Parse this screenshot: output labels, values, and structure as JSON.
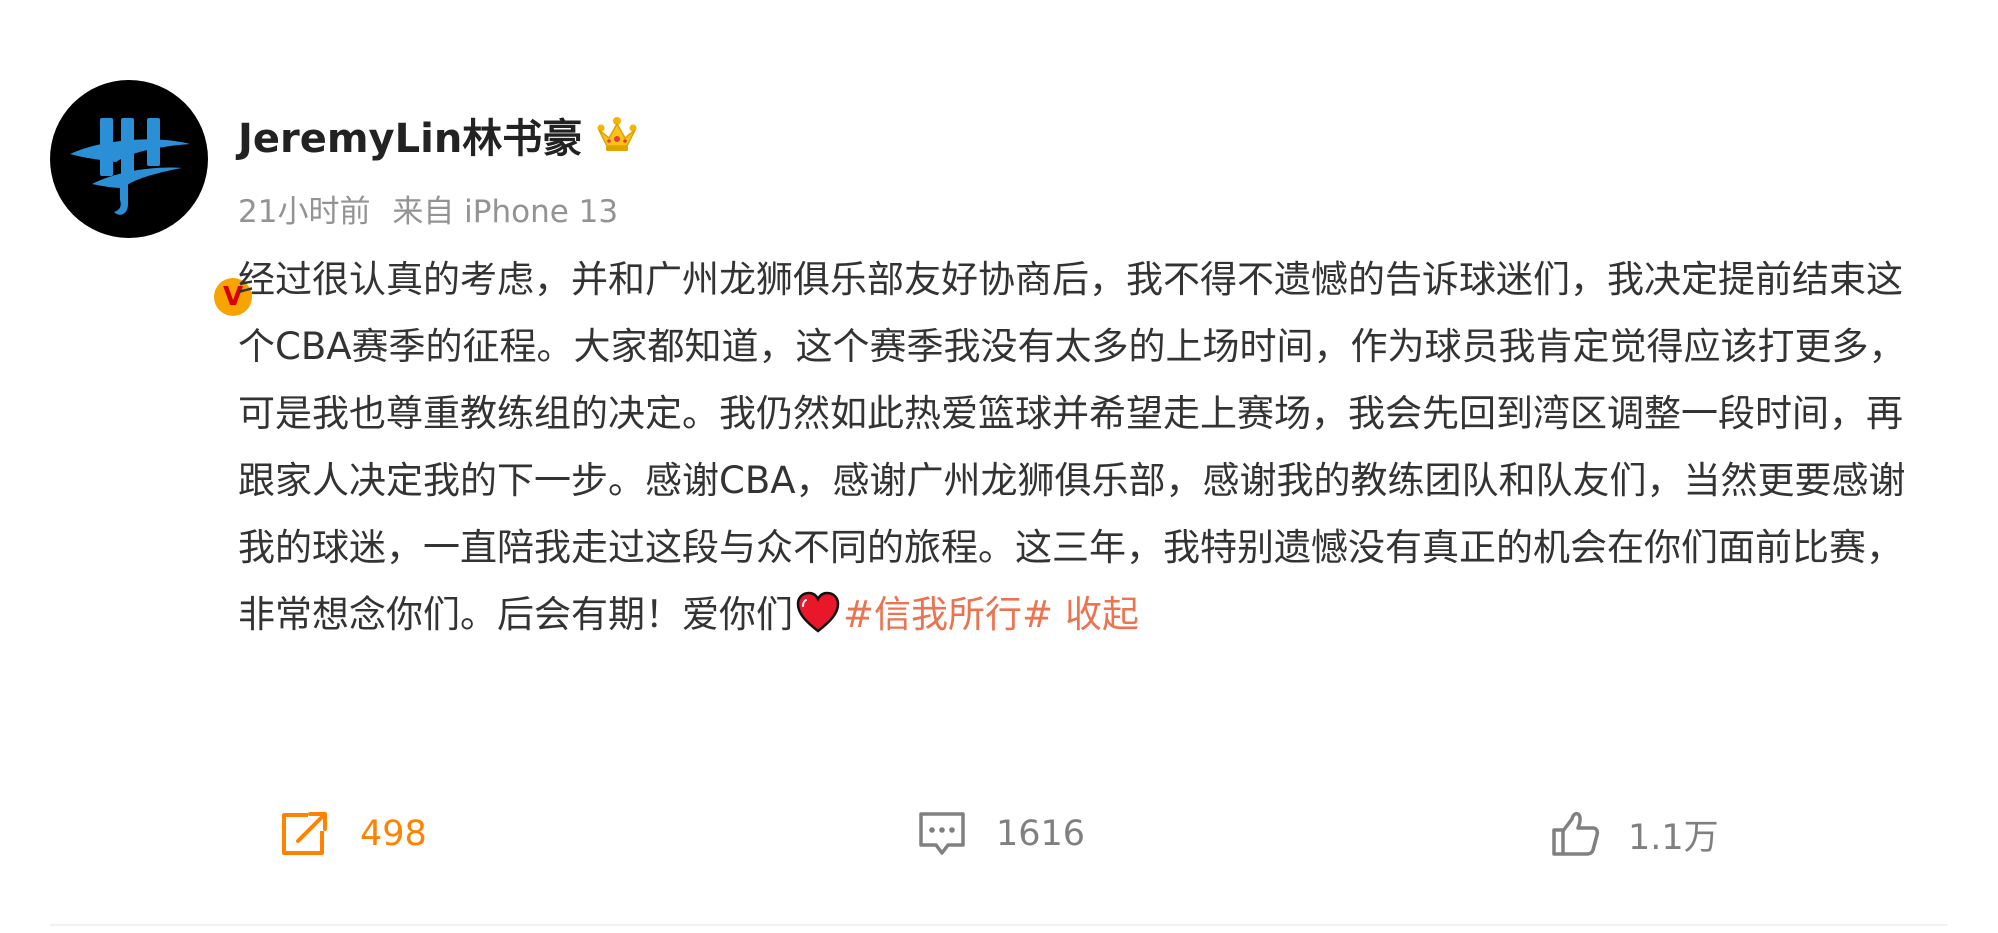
{
  "post": {
    "username": "JeremyLin林书豪",
    "crown_icon": "crown-icon",
    "verified_badge": "V",
    "time": "21小时前",
    "source": "来自 iPhone 13",
    "content_text": "经过很认真的考虑，并和广州龙狮俱乐部友好协商后，我不得不遗憾的告诉球迷们，我决定提前结束这个CBA赛季的征程。大家都知道，这个赛季我没有太多的上场时间，作为球员我肯定觉得应该打更多，可是我也尊重教练组的决定。我仍然如此热爱篮球并希望走上赛场，我会先回到湾区调整一段时间，再跟家人决定我的下一步。感谢CBA，感谢广州龙狮俱乐部，感谢我的教练团队和队友们，当然更要感谢我的球迷，一直陪我走过这段与众不同的旅程。这三年，我特别遗憾没有真正的机会在你们面前比赛，非常想念你们。后会有期！爱你们",
    "emoji_icon": "red-heart-icon",
    "hashtag": "#信我所行#",
    "collapse_label": "收起"
  },
  "actions": {
    "repost": {
      "icon": "repost-icon",
      "count": "498"
    },
    "comment": {
      "icon": "comment-icon",
      "count": "1616"
    },
    "like": {
      "icon": "thumbs-up-icon",
      "count": "1.1万"
    }
  },
  "colors": {
    "link": "#eb7350",
    "repost_active": "#ff8200",
    "muted": "#939393",
    "text": "#333333",
    "avatar_logo": "#2b8fd6",
    "verified": "#f7a400"
  }
}
